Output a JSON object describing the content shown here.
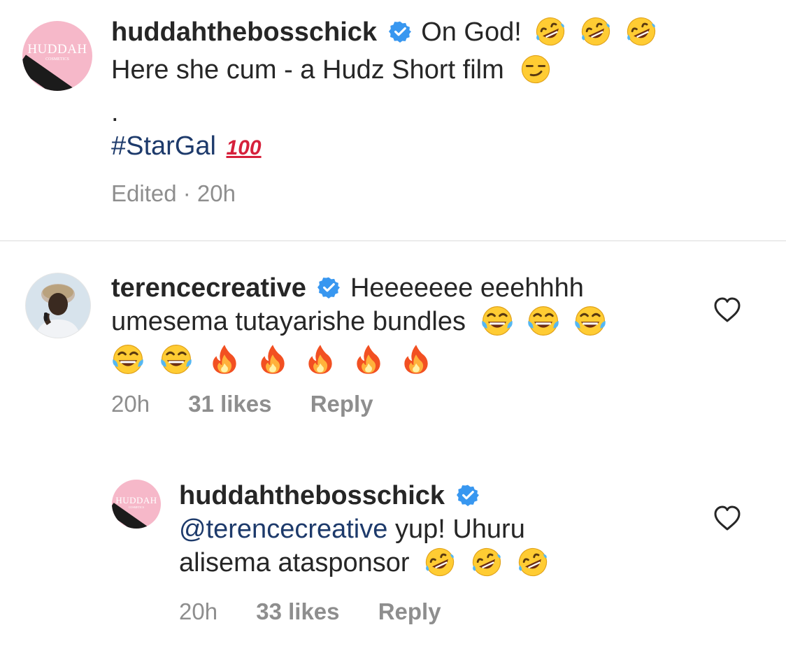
{
  "caption": {
    "username": "huddahthebosschick",
    "line1": "On God!",
    "line1_emojis": [
      "rofl-emoji",
      "rofl-emoji",
      "rofl-emoji"
    ],
    "line2": "Here she cum - a Hudz Short film",
    "line2_emoji": "smirk-emoji",
    "dot": ".",
    "hashtag": "#StarGal",
    "hashtag_emoji": "hundred-points-emoji",
    "meta": "Edited · 20h"
  },
  "comment": {
    "username": "terencecreative",
    "line1": "Heeeeeee eeehhhh",
    "line2": "umesema tutayarishe bundles",
    "line2_emojis": [
      "joy-emoji",
      "joy-emoji",
      "joy-emoji"
    ],
    "line3_emojis": [
      "joy-emoji",
      "joy-emoji",
      "fire-emoji",
      "fire-emoji",
      "fire-emoji",
      "fire-emoji",
      "fire-emoji"
    ],
    "time": "20h",
    "likes": "31 likes",
    "reply": "Reply"
  },
  "reply": {
    "username": "huddahthebosschick",
    "mention": "@terencecreative",
    "line1_rest": " yup! Uhuru",
    "line2": "alisema atasponsor",
    "line2_emojis": [
      "rofl-emoji",
      "rofl-emoji",
      "rofl-emoji"
    ],
    "time": "20h",
    "likes": "33 likes",
    "reply": "Reply"
  },
  "avatar_logo": "HUDDAH",
  "avatar_logo_sub": "COSMETICS",
  "colors": {
    "verified": "#3897f0",
    "hashtag": "#1d3a6b",
    "meta": "#8e8e8e",
    "avatar_pink": "#f6b8c9"
  }
}
